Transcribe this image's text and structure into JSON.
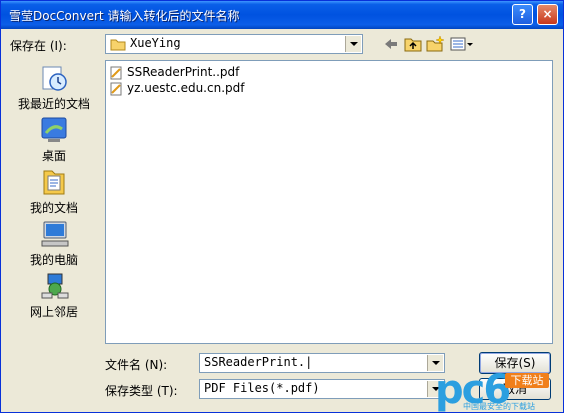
{
  "title": "雪莹DocConvert 请输入转化后的文件名称",
  "title_buttons": {
    "help": "?",
    "close": "×"
  },
  "save_in": {
    "label": "保存在 (I):",
    "value": "XueYing"
  },
  "places": [
    {
      "label": "我最近的文档",
      "icon": "recent-documents-icon"
    },
    {
      "label": "桌面",
      "icon": "desktop-icon"
    },
    {
      "label": "我的文档",
      "icon": "my-documents-icon"
    },
    {
      "label": "我的电脑",
      "icon": "my-computer-icon"
    },
    {
      "label": "网上邻居",
      "icon": "network-places-icon"
    }
  ],
  "files": [
    {
      "name": "SSReaderPrint..pdf"
    },
    {
      "name": "yz.uestc.edu.cn.pdf"
    }
  ],
  "filename": {
    "label": "文件名 (N):",
    "value": "SSReaderPrint.|"
  },
  "filetype": {
    "label": "保存类型 (T):",
    "value": "PDF Files(*.pdf)"
  },
  "buttons": {
    "save": "保存(S)",
    "cancel": "取消"
  },
  "watermark": {
    "logo": "pc6",
    "badge": "下载站",
    "sub": "中国最安全的下载站"
  },
  "colors": {
    "titlebar": "#0052e0",
    "dialog_bg": "#ece9d8",
    "accent": "#2b9fe0"
  }
}
